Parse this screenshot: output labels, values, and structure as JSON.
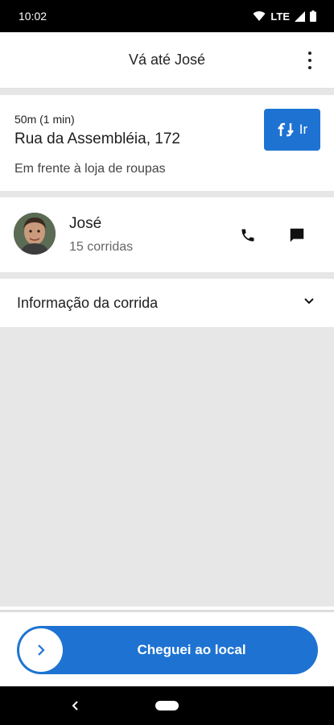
{
  "status_bar": {
    "time": "10:02",
    "network": "LTE"
  },
  "app_bar": {
    "title": "Vá até José"
  },
  "destination": {
    "eta": "50m (1 min)",
    "address": "Rua da Assembléia, 172",
    "note": "Em frente à loja de roupas",
    "go_label": "Ir"
  },
  "contact": {
    "name": "José",
    "rides": "15 corridas"
  },
  "info": {
    "label": "Informação da corrida"
  },
  "action": {
    "arrived_label": "Cheguei ao local"
  },
  "colors": {
    "accent": "#1e73d2",
    "background": "#e7e7e7"
  }
}
